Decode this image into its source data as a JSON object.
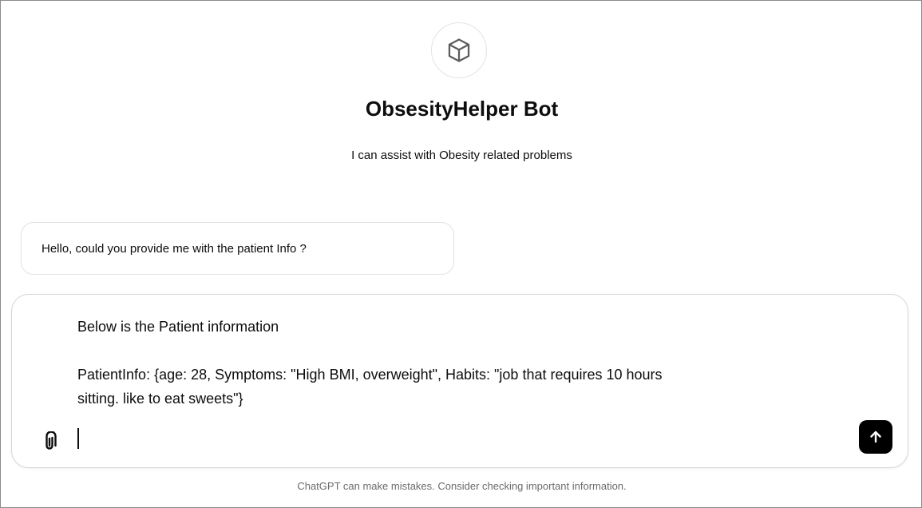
{
  "gpt": {
    "name": "ObsesityHelper Bot",
    "description": "I can assist with Obesity related problems",
    "avatar_icon": "cube-icon"
  },
  "starters": [
    {
      "label": "Hello, could you provide me with the patient Info ?"
    }
  ],
  "composer": {
    "lines": [
      "Below is the Patient information",
      "",
      "PatientInfo: {age: 28, Symptoms: \"High BMI, overweight\", Habits: \"job that requires 10 hours",
      "sitting. like to eat sweets\"}"
    ],
    "attach_icon": "paperclip-icon",
    "send_icon": "arrow-up-icon"
  },
  "footer": {
    "disclaimer": "ChatGPT can make mistakes. Consider checking important information."
  },
  "colors": {
    "send_button_bg": "#000000",
    "border": "#e3e3e3",
    "muted_text": "#6b6b6b"
  }
}
